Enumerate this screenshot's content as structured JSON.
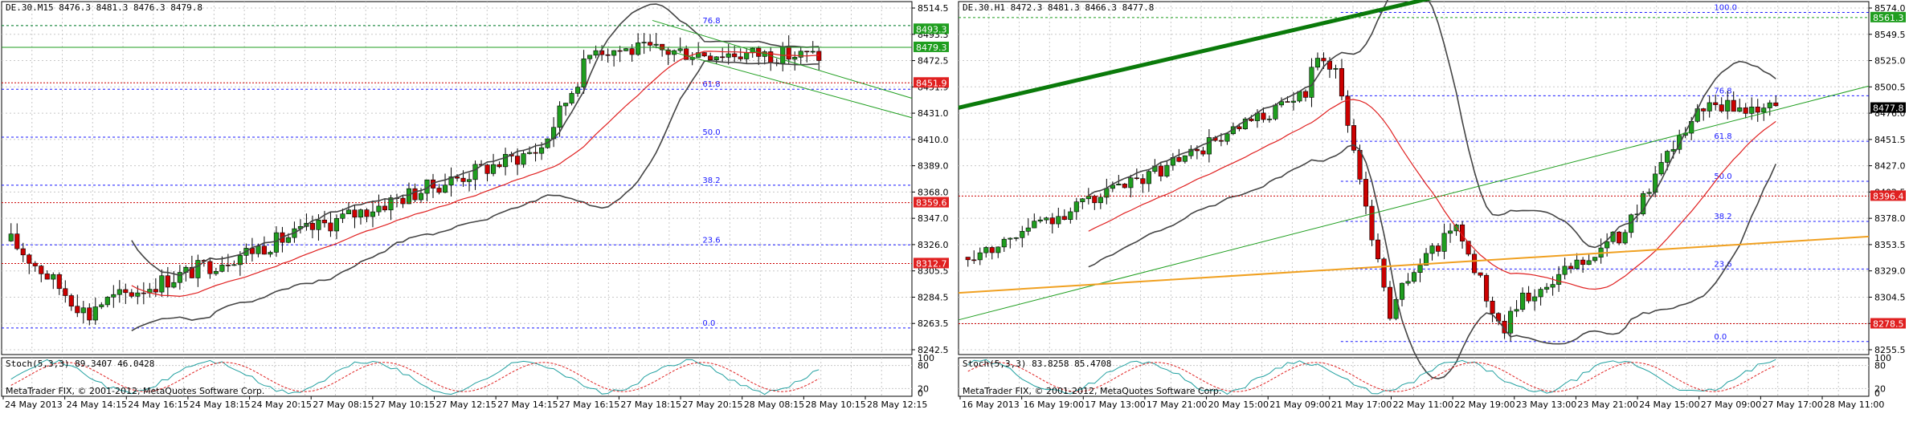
{
  "charts": [
    {
      "id": "left",
      "title": "DE.30.M15",
      "ohlc": "8476.3 8481.3 8476.3 8479.8",
      "stoch_label": "Stoch(5,3,3) 89.3407 46.0428",
      "stoch_ticks": [
        "100",
        "80",
        "20",
        "0"
      ],
      "copyright": "MetaTrader FIX, © 2001-2012, MetaQuotes Software Corp.",
      "price_ticks": [
        "8514.5",
        "8493.3",
        "8472.5",
        "8451.9",
        "8431.0",
        "8410.0",
        "8389.0",
        "8368.0",
        "8347.0",
        "8326.0",
        "8305.5",
        "8284.5",
        "8263.5",
        "8242.5"
      ],
      "price_min": 8242.5,
      "price_max": 8514.5,
      "fib_levels": [
        {
          "label": "76.8",
          "price": 8496.0
        },
        {
          "label": "61.8",
          "price": 8447.0
        },
        {
          "label": "50.0",
          "price": 8410.0
        },
        {
          "label": "38.2",
          "price": 8373.0
        },
        {
          "label": "23.6",
          "price": 8327.0
        },
        {
          "label": "0.0",
          "price": 8263.0
        }
      ],
      "price_tags": [
        {
          "text": "8493.3",
          "price": 8493.3,
          "color": "#1f9e1f"
        },
        {
          "text": "8479.3",
          "price": 8479.3,
          "color": "#1f9e1f"
        },
        {
          "text": "8451.9",
          "price": 8451.9,
          "color": "#e02020"
        },
        {
          "text": "8359.6",
          "price": 8359.6,
          "color": "#e02020"
        },
        {
          "text": "8312.7",
          "price": 8312.7,
          "color": "#e02020"
        }
      ],
      "time_labels": [
        "24 May 2013",
        "24 May 14:15",
        "24 May 16:15",
        "24 May 18:15",
        "24 May 20:15",
        "27 May 08:15",
        "27 May 10:15",
        "27 May 12:15",
        "27 May 14:15",
        "27 May 16:15",
        "27 May 18:15",
        "27 May 20:15",
        "28 May 08:15",
        "28 May 10:15",
        "28 May 12:15"
      ]
    },
    {
      "id": "right",
      "title": "DE.30.H1",
      "ohlc": "8472.3 8481.3 8466.3 8477.8",
      "stoch_label": "Stoch(5,3,3) 83.8258 85.4708",
      "stoch_ticks": [
        "100",
        "80",
        "20",
        "0"
      ],
      "copyright": "MetaTrader FIX, © 2001-2012, MetaQuotes Software Corp.",
      "price_ticks": [
        "8574.0",
        "8549.5",
        "8525.0",
        "8500.5",
        "8476.0",
        "8451.5",
        "8427.0",
        "8402.5",
        "8378.0",
        "8353.5",
        "8329.0",
        "8304.5",
        "8280.0",
        "8255.5"
      ],
      "price_min": 8250.0,
      "price_max": 8576.0,
      "fib_levels": [
        {
          "label": "100.0",
          "price": 8566.0
        },
        {
          "label": "76.8",
          "price": 8489.0
        },
        {
          "label": "61.8",
          "price": 8447.0
        },
        {
          "label": "50.0",
          "price": 8410.0
        },
        {
          "label": "38.2",
          "price": 8373.0
        },
        {
          "label": "23.6",
          "price": 8329.0
        },
        {
          "label": "0.0",
          "price": 8262.0
        }
      ],
      "price_tags": [
        {
          "text": "8561.3",
          "price": 8561.3,
          "color": "#1f9e1f"
        },
        {
          "text": "8477.8",
          "price": 8477.8,
          "color": "#000000"
        },
        {
          "text": "8396.4",
          "price": 8396.4,
          "color": "#e02020"
        },
        {
          "text": "8278.5",
          "price": 8278.5,
          "color": "#e02020"
        }
      ],
      "time_labels": [
        "16 May 2013",
        "16 May 19:00",
        "17 May 13:00",
        "17 May 21:00",
        "20 May 15:00",
        "21 May 09:00",
        "21 May 17:00",
        "22 May 11:00",
        "22 May 19:00",
        "23 May 13:00",
        "23 May 21:00",
        "24 May 15:00",
        "27 May 09:00",
        "27 May 17:00",
        "28 May 11:00"
      ]
    }
  ],
  "colors": {
    "bull": "#1f9e1f",
    "bear": "#cc0000",
    "band": "#444444",
    "ma": "#e02020",
    "trend_green": "#1f9e1f",
    "trend_orange": "#f0a020",
    "fib": "#1a1aff",
    "grid": "#c8c8c8"
  }
}
